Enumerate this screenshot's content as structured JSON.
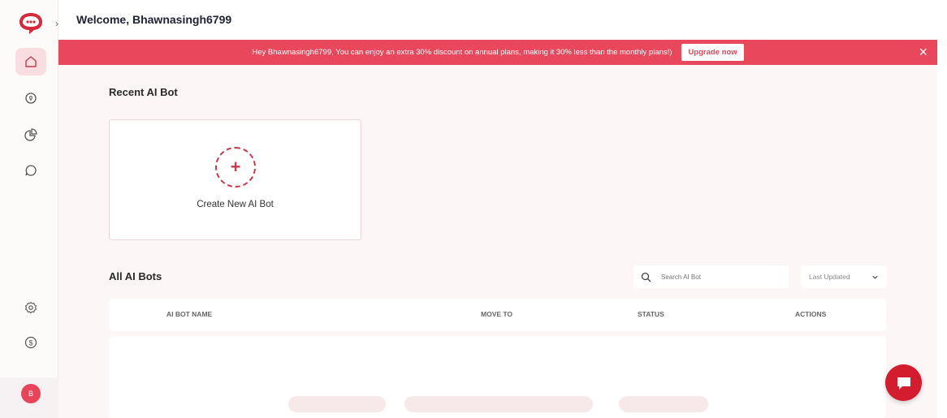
{
  "header": {
    "welcome": "Welcome, Bhawnasingh6799"
  },
  "banner": {
    "text": "Hey Bhawnasingh6799, You can enjoy an extra 30% discount on annual plans, making it 30% less than the monthly plans!)",
    "upgrade_label": "Upgrade now",
    "close_symbol": "×"
  },
  "sidebar": {
    "expand_symbol": "›",
    "items": [
      {
        "icon": "home-icon",
        "active": true
      },
      {
        "icon": "bulb-icon",
        "active": false
      },
      {
        "icon": "pie-chart-icon",
        "active": false
      },
      {
        "icon": "chat-icon",
        "active": false
      },
      {
        "icon": "settings-icon",
        "active": false
      },
      {
        "icon": "dollar-icon",
        "active": false
      }
    ],
    "avatar_initial": "B"
  },
  "recent": {
    "title": "Recent AI Bot",
    "create_symbol": "+",
    "create_label": "Create New AI Bot"
  },
  "all_bots": {
    "title": "All AI Bots",
    "search_placeholder": "Search AI Bot",
    "sort_value": "Last Updated",
    "columns": [
      "AI BOT NAME",
      "MOVE TO",
      "STATUS",
      "ACTIONS"
    ]
  },
  "colors": {
    "brand": "#e8475c",
    "fab": "#d31c2e",
    "active_bg": "#f9dde1"
  }
}
